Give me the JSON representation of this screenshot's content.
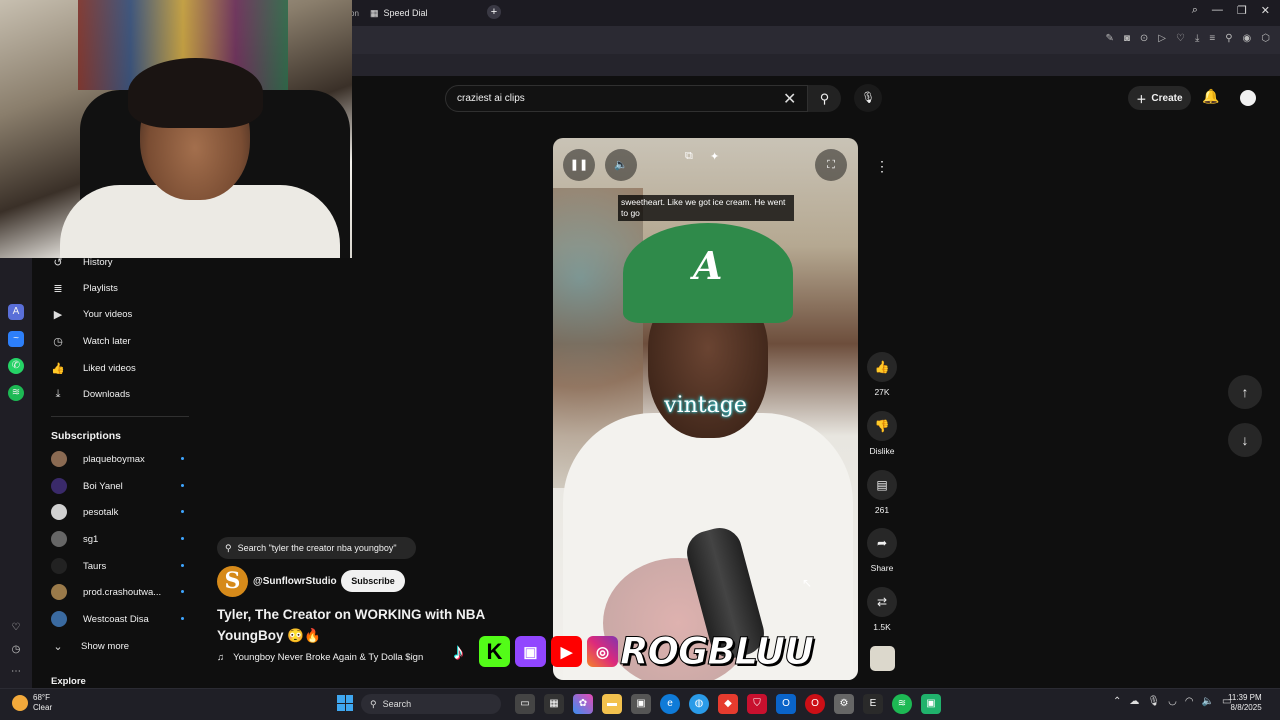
{
  "browser": {
    "tabs": [
      {
        "label": "on"
      },
      {
        "label": "Speed Dial"
      }
    ],
    "new_tab": "+",
    "window_controls": [
      "⌕",
      "—",
      "❐",
      "✕"
    ]
  },
  "youtube": {
    "search": {
      "value": "craziest ai clips"
    },
    "create_label": "Create",
    "sidebar": {
      "items": [
        {
          "label": "History",
          "icon": "history-icon"
        },
        {
          "label": "Playlists",
          "icon": "playlist-icon"
        },
        {
          "label": "Your videos",
          "icon": "your-videos-icon"
        },
        {
          "label": "Watch later",
          "icon": "clock-icon"
        },
        {
          "label": "Liked videos",
          "icon": "thumbs-up-icon"
        },
        {
          "label": "Downloads",
          "icon": "download-icon"
        }
      ],
      "subscriptions_title": "Subscriptions",
      "subscriptions": [
        {
          "name": "plaqueboymax",
          "color": "#8a6a52"
        },
        {
          "name": "Boi Yanel",
          "color": "#3a2a6a"
        },
        {
          "name": "pesotalk",
          "color": "#d0d0d0"
        },
        {
          "name": "sg1",
          "color": "#666666"
        },
        {
          "name": "Taurs",
          "color": "#222222"
        },
        {
          "name": "prod.crashoutwa...",
          "color": "#9a7a4a"
        },
        {
          "name": "Westcoast Disa",
          "color": "#3a6aa0"
        }
      ],
      "show_more": "Show more",
      "explore": "Explore"
    },
    "short": {
      "caption": "sweetheart. Like we got ice cream. He went to go",
      "overlay_word": "vintage",
      "related_search": "Search \"tyler the creator nba youngboy\"",
      "channel": "@SunflowrStudio",
      "channel_initial": "S",
      "subscribe": "Subscribe",
      "title": "Tyler, The Creator on WORKING with NBA YoungBoy 😳🔥",
      "music": "Youngboy Never Broke Again & Ty Dolla $ign"
    },
    "actions": {
      "likes": "27K",
      "dislike": "Dislike",
      "comments": "261",
      "share": "Share",
      "remix": "1.5K"
    }
  },
  "stream_overlay": {
    "brand": "ROGBLUU",
    "social": [
      "tiktok",
      "kick",
      "twitch",
      "youtube",
      "instagram"
    ]
  },
  "taskbar": {
    "weather_temp": "68°F",
    "weather_desc": "Clear",
    "search": "Search",
    "time": "11:39 PM",
    "date": "8/8/2025"
  },
  "colors": {
    "accent": "#3ea6ff",
    "bg": "#0f0f0f",
    "subscribe_bg": "#f1f1f1"
  }
}
